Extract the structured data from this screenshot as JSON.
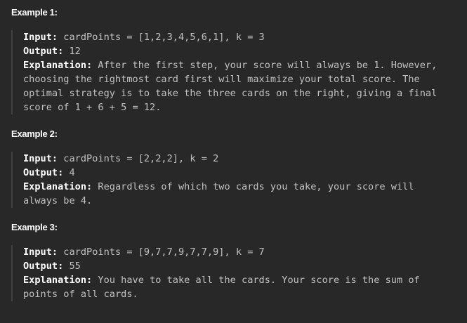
{
  "examples": [
    {
      "heading": "Example 1:",
      "input_label": "Input:",
      "input": "cardPoints = [1,2,3,4,5,6,1], k = 3",
      "output_label": "Output:",
      "output": "12",
      "explanation_label": "Explanation:",
      "explanation": "After the first step, your score will always be 1. However, choosing the rightmost card first will maximize your total score. The optimal strategy is to take the three cards on the right, giving a final score of 1 + 6 + 5 = 12."
    },
    {
      "heading": "Example 2:",
      "input_label": "Input:",
      "input": "cardPoints = [2,2,2], k = 2",
      "output_label": "Output:",
      "output": "4",
      "explanation_label": "Explanation:",
      "explanation": "Regardless of which two cards you take, your score will always be 4."
    },
    {
      "heading": "Example 3:",
      "input_label": "Input:",
      "input": "cardPoints = [9,7,7,9,7,7,9], k = 7",
      "output_label": "Output:",
      "output": "55",
      "explanation_label": "Explanation:",
      "explanation": "You have to take all the cards. Your score is the sum of points of all cards."
    }
  ]
}
